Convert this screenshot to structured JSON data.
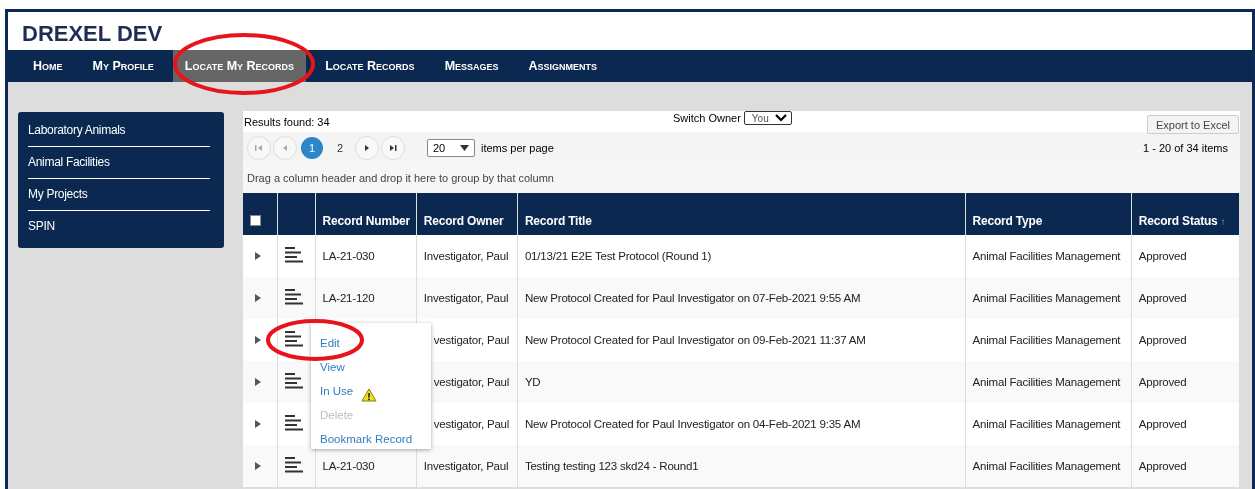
{
  "app_title": "DREXEL DEV",
  "nav": [
    {
      "label": "Home",
      "selected": false
    },
    {
      "label": "My Profile",
      "selected": false
    },
    {
      "label": "Locate My Records",
      "selected": true
    },
    {
      "label": "Locate Records",
      "selected": false
    },
    {
      "label": "Messages",
      "selected": false
    },
    {
      "label": "Assignments",
      "selected": false
    }
  ],
  "sidebar": {
    "items": [
      {
        "label": "Laboratory Animals"
      },
      {
        "label": "Animal Facilities"
      },
      {
        "label": "My Projects"
      },
      {
        "label": "SPIN"
      }
    ]
  },
  "results": "Results found: 34",
  "switch_owner": {
    "label": "Switch Owner",
    "value": "You"
  },
  "export_button": "Export to Excel",
  "pager": {
    "pages": [
      {
        "label": "1",
        "selected": true
      },
      {
        "label": "2",
        "selected": false
      }
    ],
    "page_size": "20",
    "items_per_page": "items per page",
    "range": "1 - 20 of 34 items"
  },
  "group_hint": "Drag a column header and drop it here to group by that column",
  "table": {
    "select_all": {
      "checked": false
    },
    "columns": [
      {
        "label": "Record Number"
      },
      {
        "label": "Record Owner"
      },
      {
        "label": "Record Title"
      },
      {
        "label": "Record Type"
      },
      {
        "label": "Record Status",
        "sort": "↑"
      }
    ],
    "rows": [
      {
        "number": "LA-21-030",
        "owner": "Investigator, Paul",
        "title": "01/13/21 E2E Test Protocol (Round 1)",
        "type": "Animal Facilities Management",
        "status": "Approved"
      },
      {
        "number": "LA-21-120",
        "owner": "Investigator, Paul",
        "title": "New Protocol Created for Paul Investigator on 07-Feb-2021 9:55 AM",
        "type": "Animal Facilities Management",
        "status": "Approved"
      },
      {
        "owner": "vestigator, Paul",
        "title": "New Protocol Created for Paul Investigator on 09-Feb-2021 11:37 AM",
        "type": "Animal Facilities Management",
        "status": "Approved"
      },
      {
        "owner": "vestigator, Paul",
        "title": "YD",
        "type": "Animal Facilities Management",
        "status": "Approved"
      },
      {
        "owner": "vestigator, Paul",
        "title": "New Protocol Created for Paul Investigator on 04-Feb-2021 9:35 AM",
        "type": "Animal Facilities Management",
        "status": "Approved"
      },
      {
        "number": "LA-21-030",
        "owner": "Investigator, Paul",
        "title": "Testing testing 123 skd24 - Round1",
        "type": "Animal Facilities Management",
        "status": "Approved"
      }
    ]
  },
  "context_menu": {
    "items": [
      {
        "label": "Edit",
        "disabled": false
      },
      {
        "label": "View",
        "disabled": false
      },
      {
        "label": "In Use",
        "disabled": false,
        "warning": true
      },
      {
        "label": "Delete",
        "disabled": true
      },
      {
        "label": "Bookmark Record",
        "disabled": false
      }
    ]
  }
}
